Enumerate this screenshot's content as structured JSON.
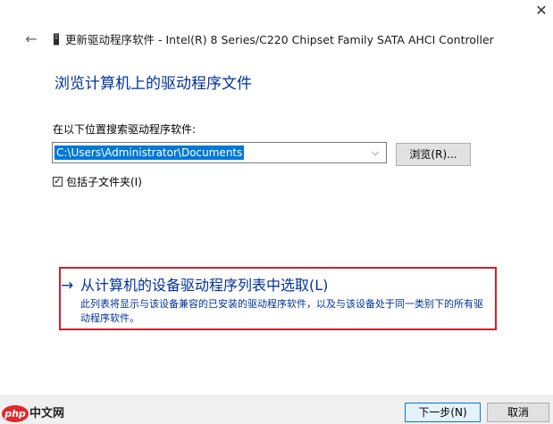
{
  "window": {
    "title": "更新驱动程序软件 - Intel(R) 8 Series/C220 Chipset Family SATA AHCI Controller",
    "close_glyph": "✕",
    "back_glyph": "←"
  },
  "page": {
    "heading": "浏览计算机上的驱动程序文件",
    "search_label": "在以下位置搜索驱动程序软件:",
    "path_value": "C:\\Users\\Administrator\\Documents",
    "dropdown_glyph": "⌵",
    "browse_label": "浏览(R)...",
    "include_subfolders_label": "包括子文件夹(I)",
    "include_subfolders_checked": true,
    "check_glyph": "✓"
  },
  "pick_option": {
    "arrow_glyph": "→",
    "title": "从计算机的设备驱动程序列表中选取(L)",
    "description": "此列表将显示与该设备兼容的已安装的驱动程序软件，以及与该设备处于同一类别下的所有驱动程序软件。"
  },
  "footer": {
    "next_label": "下一步(N)",
    "cancel_label": "取消"
  },
  "watermark": {
    "logo_text": "php",
    "site_text": "中文网"
  },
  "colors": {
    "link_blue": "#003399",
    "selection_blue": "#0078d7",
    "highlight_red": "#c8232c"
  }
}
